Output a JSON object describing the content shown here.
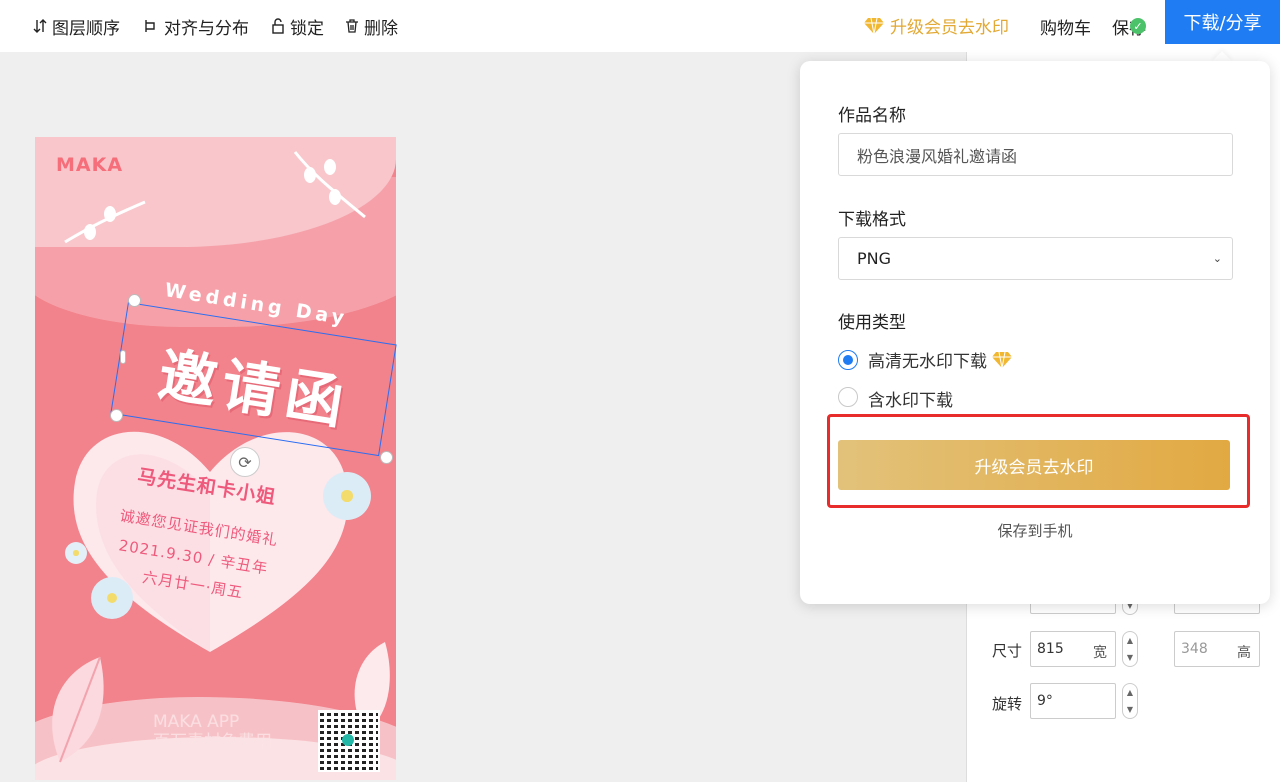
{
  "toolbar": {
    "layer_order": "图层顺序",
    "align": "对齐与分布",
    "lock": "锁定",
    "delete": "删除",
    "vip": "升级会员去水印",
    "cart": "购物车",
    "save": "保存",
    "share": "下载/分享"
  },
  "poster": {
    "logo": "MAKA",
    "wedding_day": "Wedding Day",
    "title": "邀请函",
    "names": "马先生和卡小姐",
    "line1": "诚邀您见证我们的婚礼",
    "line2": "2021.9.30 / 辛丑年",
    "line3": "六月廿一·周五",
    "app_line1": "MAKA APP",
    "app_line2": "百万素材免费用"
  },
  "popover": {
    "name_label": "作品名称",
    "name_value": "粉色浪漫风婚礼邀请函",
    "format_label": "下载格式",
    "format_value": "PNG",
    "usage_label": "使用类型",
    "option_hd": "高清无水印下载",
    "option_watermark": "含水印下载",
    "upgrade_button": "升级会员去水印",
    "save_to_phone": "保存到手机"
  },
  "right_panel": {
    "size_label": "尺寸",
    "width_value": "815",
    "width_unit": "宽",
    "height_value": "348",
    "height_unit": "高",
    "rotate_label": "旋转",
    "rotate_value": "9°"
  },
  "colors": {
    "accent_blue": "#1f7cf2",
    "vip_gold": "#e2a935",
    "highlight_red": "#e82c2c",
    "poster_pink": "#f2828b"
  }
}
